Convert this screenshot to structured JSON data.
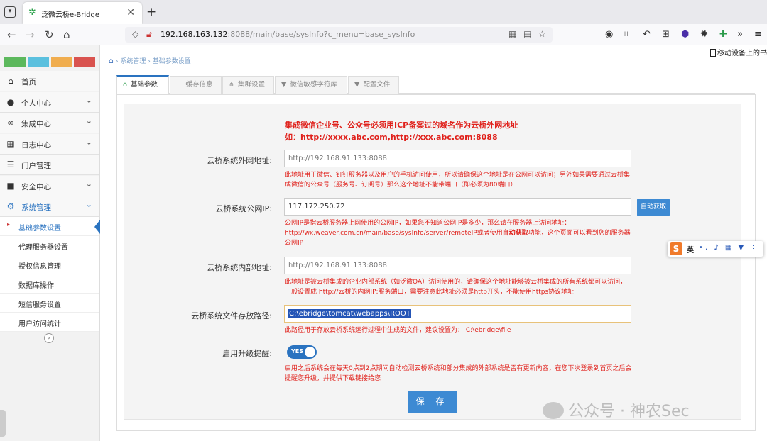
{
  "browser": {
    "tab_title": "泛微云桥e-Bridge",
    "url_host": "192.168.163.132",
    "url_rest": ":8088/main/base/sysInfo?c_menu=base_sysInfo",
    "bookmark_label": "移动设备上的书签"
  },
  "breadcrumb": {
    "items": [
      "系统管理",
      "基础参数设置"
    ]
  },
  "sidebar": {
    "top_colors": [
      "#5cb85c",
      "#5bc0de",
      "#f0ad4e",
      "#d9534f"
    ],
    "items": [
      {
        "label": "首页",
        "icon": "home-icon",
        "glyph": "⌂",
        "chevron": ""
      },
      {
        "label": "个人中心",
        "icon": "user-icon",
        "glyph": "●",
        "chevron": "⌄"
      },
      {
        "label": "集成中心",
        "icon": "link-icon",
        "glyph": "∞",
        "chevron": "⌄"
      },
      {
        "label": "日志中心",
        "icon": "calendar-icon",
        "glyph": "▦",
        "chevron": "⌄"
      },
      {
        "label": "门户管理",
        "icon": "list-icon",
        "glyph": "☰",
        "chevron": ""
      },
      {
        "label": "安全中心",
        "icon": "lock-icon",
        "glyph": "■",
        "chevron": "⌄"
      },
      {
        "label": "系统管理",
        "icon": "gear-icon",
        "glyph": "⚙",
        "chevron": "⌄"
      }
    ],
    "subitems": [
      {
        "label": "基础参数设置"
      },
      {
        "label": "代理服务器设置"
      },
      {
        "label": "授权信息管理"
      },
      {
        "label": "数据库操作"
      },
      {
        "label": "短信服务设置"
      },
      {
        "label": "用户访问统计"
      }
    ]
  },
  "content_tabs": [
    {
      "label": "基础参数",
      "glyph": "⌂"
    },
    {
      "label": "缓存信息",
      "glyph": "☷"
    },
    {
      "label": "集群设置",
      "glyph": "⋔"
    },
    {
      "label": "微信敏感字符库",
      "glyph": "▼"
    },
    {
      "label": "配置文件",
      "glyph": "▼"
    }
  ],
  "form": {
    "warning_line1": "集成微信企业号、公众号必须用ICP备案过的域名作为云桥外网地址",
    "warning_line2": "如：http://xxxx.abc.com,http://xxx.abc.com:8088",
    "external_label": "云桥系统外网地址:",
    "external_placeholder": "http://192.168.91.133:8088",
    "external_hint": "此地址用于微信、钉钉服务器以及用户的手机访问使用，所以请确保这个地址是在公网可以访问；另外如果需要通过云桥集成微信的公众号（服务号、订阅号）那么这个地址不能带端口（即必须为80端口）",
    "public_ip_label": "云桥系统公网IP:",
    "public_ip_value": "117.172.250.72",
    "auto_button": "自动获取",
    "public_ip_hint_a": "公网IP是指云桥服务器上网使用的公网IP，如果您不知道公网IP是多少，那么请在服务器上访问地址：http://wx.weaver.com.cn/main/base/sysInfo/server/remoteIP或者使用",
    "public_ip_hint_bold": "自动获取",
    "public_ip_hint_b": "功能，这个页面可以看到您的服务器公网IP",
    "internal_label": "云桥系统内部地址:",
    "internal_placeholder": "http://192.168.91.133:8088",
    "internal_hint": "此地址是被云桥集成的企业内部系统（如泛微OA）访问使用的，请确保这个地址能够被云桥集成的所有系统都可以访问，一般设置成 http://云桥的内网IP:服务端口，需要注意此地址必须是http开头，不能使用https协议地址",
    "path_label": "云桥系统文件存放路径:",
    "path_value": "C:\\ebridge\\tomcat\\webapps\\ROOT",
    "path_hint": "此路径用于存放云桥系统运行过程中生成的文件，建议设置为：  C:\\ebridge\\file",
    "upgrade_label": "启用升级提醒:",
    "toggle_text": "YES",
    "upgrade_hint": "启用之后系统会在每天0点到2点期间自动检测云桥系统和部分集成的外部系统是否有更新内容，在您下次登录到首页之后会提醒您升级，并提供下载链接给您",
    "save_button": "保 存"
  },
  "ime": {
    "logo": "S",
    "lang": "英",
    "icons": "•, ♪ ▦ ▼ ⁘"
  },
  "watermark": "公众号 · 神农Sec"
}
